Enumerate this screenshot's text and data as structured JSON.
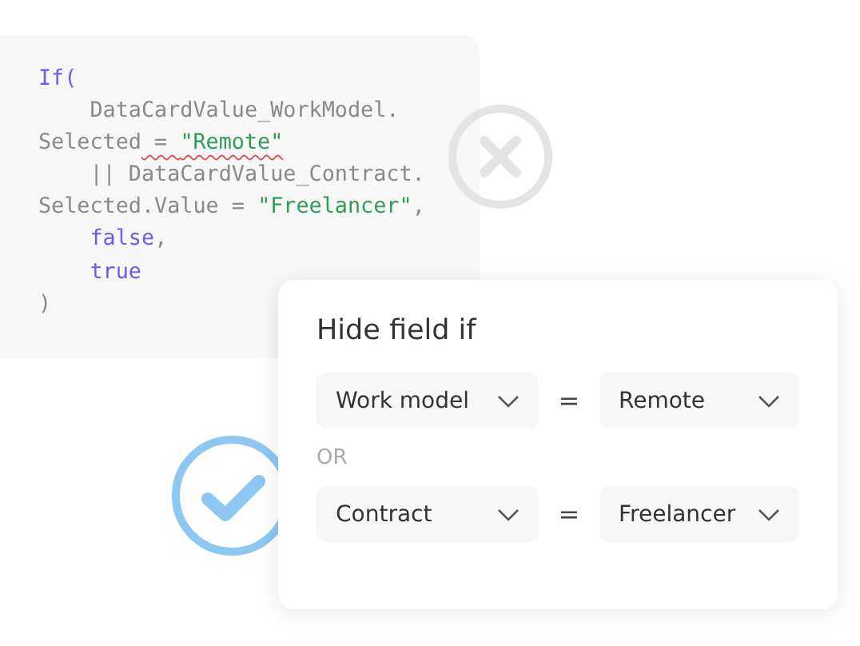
{
  "code": {
    "lines": [
      [
        {
          "text": "If(",
          "kind": "keyword"
        }
      ],
      [
        {
          "text": "    DataCardValue_WorkModel.",
          "kind": "plain"
        }
      ],
      [
        {
          "text": "Selected",
          "kind": "plain"
        },
        {
          "text": " = ",
          "kind": "plain",
          "squiggle": true
        },
        {
          "text": "\"Remote\"",
          "kind": "string",
          "squiggle": true
        }
      ],
      [
        {
          "text": "    || DataCardValue_Contract.",
          "kind": "plain"
        }
      ],
      [
        {
          "text": "Selected.Value = ",
          "kind": "plain"
        },
        {
          "text": "\"Freelancer\"",
          "kind": "string"
        },
        {
          "text": ",",
          "kind": "plain"
        }
      ],
      [
        {
          "text": "    false",
          "kind": "keyword"
        },
        {
          "text": ",",
          "kind": "plain"
        }
      ],
      [
        {
          "text": "    true",
          "kind": "keyword"
        }
      ],
      [
        {
          "text": ")",
          "kind": "plain"
        }
      ]
    ]
  },
  "card": {
    "title": "Hide field if",
    "conditions": [
      {
        "field": "Work model",
        "operator": "=",
        "value": "Remote"
      },
      {
        "field": "Contract",
        "operator": "=",
        "value": "Freelancer"
      }
    ],
    "joiner": "OR"
  }
}
